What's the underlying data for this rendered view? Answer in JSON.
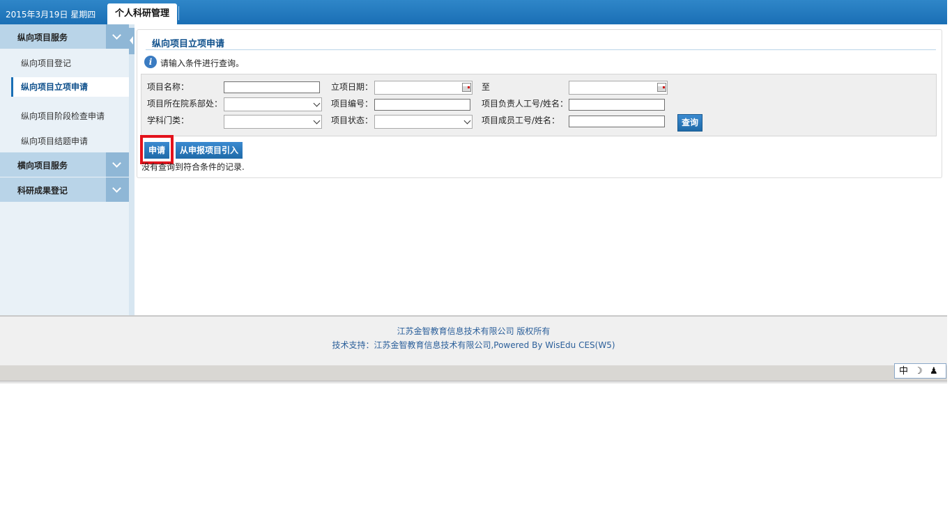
{
  "header": {
    "date": "2015年3月19日 星期四",
    "tab_label": "个人科研管理"
  },
  "sidebar": {
    "sections": [
      {
        "label": "纵向项目服务",
        "expanded": true,
        "items": [
          {
            "label": "纵向项目登记",
            "active": false
          },
          {
            "label": "纵向项目立项申请",
            "active": true
          },
          {
            "label": "纵向项目阶段检查申请",
            "active": false
          },
          {
            "label": "纵向项目结题申请",
            "active": false
          }
        ]
      },
      {
        "label": "横向项目服务",
        "expanded": false
      },
      {
        "label": "科研成果登记",
        "expanded": false
      }
    ]
  },
  "main": {
    "title": "纵向项目立项申请",
    "info_text": "请输入条件进行查询。",
    "form": {
      "project_name_label": "项目名称：",
      "project_name_value": "",
      "start_date_label": "立项日期：",
      "start_date_value": "",
      "to_label": "至",
      "end_date_value": "",
      "department_label": "项目所在院系部处：",
      "department_value": "",
      "project_no_label": "项目编号：",
      "project_no_value": "",
      "leader_label": "项目负责人工号/姓名：",
      "leader_value": "",
      "discipline_label": "学科门类：",
      "discipline_value": "",
      "status_label": "项目状态：",
      "status_value": "",
      "member_label": "项目成员工号/姓名：",
      "member_value": "",
      "query_button": "查询"
    },
    "apply_button": "申请",
    "import_button": "从申报项目引入",
    "empty_message": "没有查询到符合条件的记录."
  },
  "footer": {
    "copyright": "江苏金智教育信息技术有限公司 版权所有",
    "support": "技术支持：江苏金智教育信息技术有限公司,Powered By WisEdu CES(W5)"
  },
  "ime": {
    "mode": "中",
    "moon_icon": "☽",
    "person_icon": "♟"
  },
  "colors": {
    "header_blue": "#1a6fb5",
    "title_blue": "#0d4f8b",
    "highlight_red": "#e3121b"
  }
}
